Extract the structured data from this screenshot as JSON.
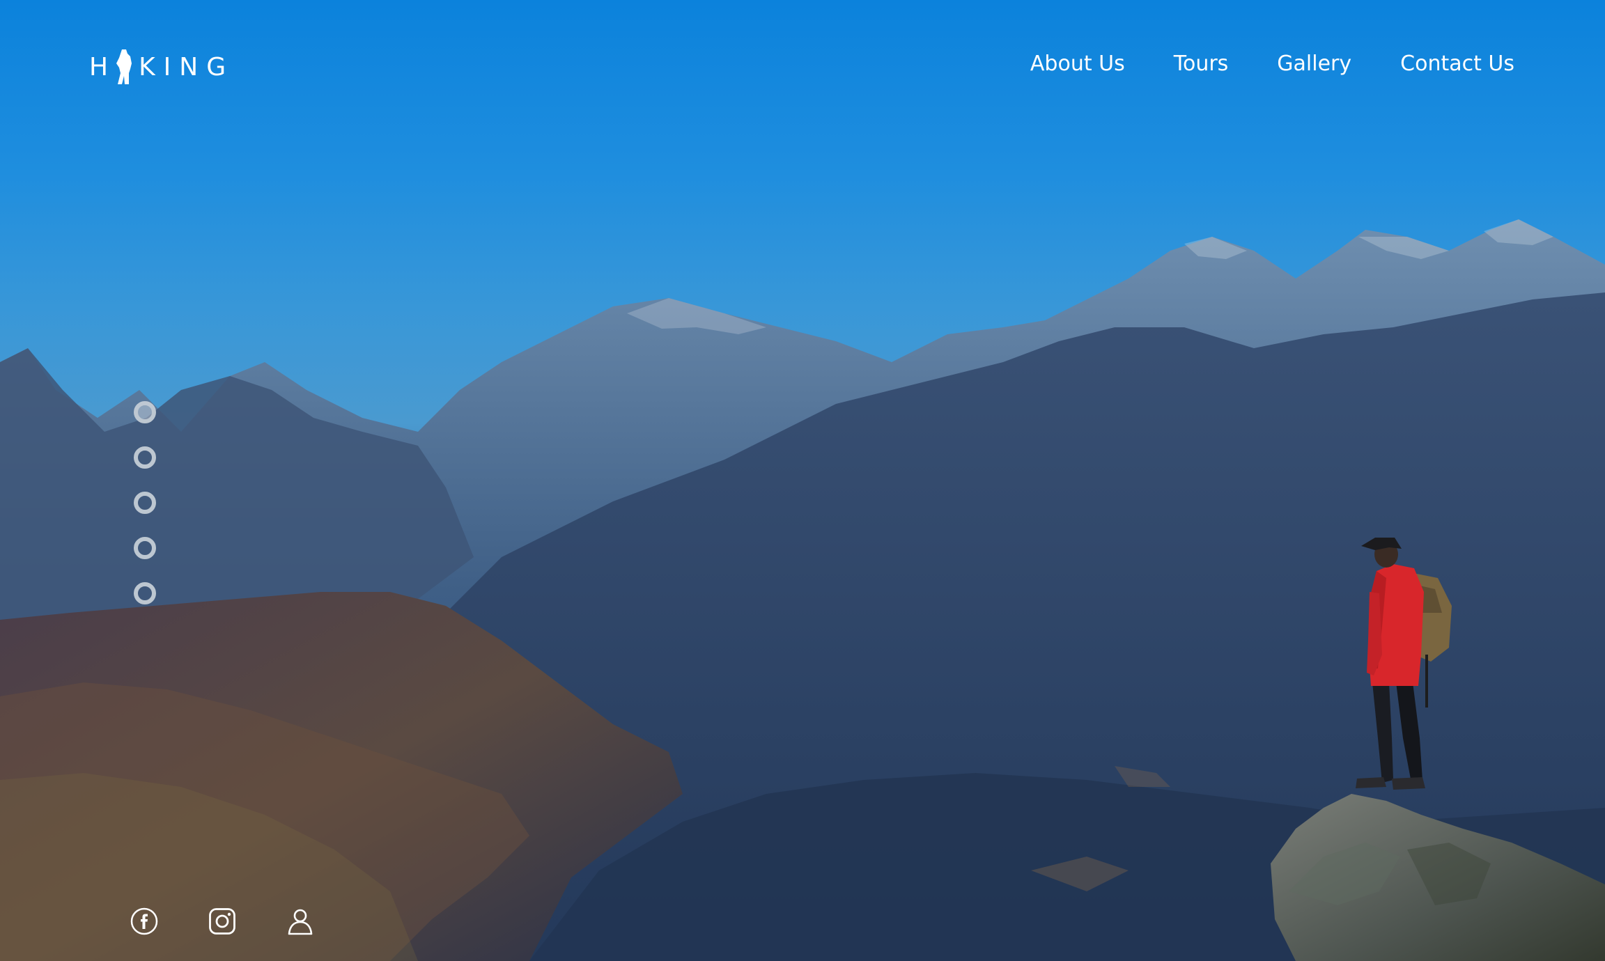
{
  "header": {
    "logo": {
      "text_prefix": "H",
      "text_suffix": "KING",
      "icon": "hiker-silhouette-icon"
    },
    "nav": [
      {
        "label": "About Us"
      },
      {
        "label": "Tours"
      },
      {
        "label": "Gallery"
      },
      {
        "label": "Contact Us"
      }
    ]
  },
  "slider": {
    "dot_count": 5,
    "active_index": 0
  },
  "social": [
    {
      "icon": "facebook-icon"
    },
    {
      "icon": "instagram-icon"
    },
    {
      "icon": "user-icon"
    }
  ],
  "colors": {
    "sky_top": "#0b82dc",
    "sky_mid": "#4a9ad0",
    "mountains": "#2d4b74",
    "jacket": "#d8262b",
    "text": "#ffffff"
  }
}
